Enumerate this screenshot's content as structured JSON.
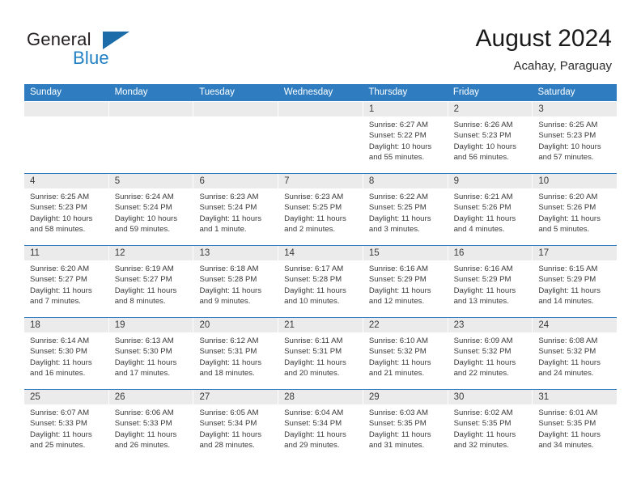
{
  "brand": {
    "name_part1": "General",
    "name_part2": "Blue"
  },
  "header": {
    "month_title": "August 2024",
    "location": "Acahay, Paraguay"
  },
  "colors": {
    "header_blue": "#2f7dc0",
    "logo_blue": "#1f7fc4",
    "daynum_band": "#ebebeb",
    "text": "#3a3a3a"
  },
  "weekdays": [
    "Sunday",
    "Monday",
    "Tuesday",
    "Wednesday",
    "Thursday",
    "Friday",
    "Saturday"
  ],
  "weeks": [
    [
      {
        "day": "",
        "empty": true
      },
      {
        "day": "",
        "empty": true
      },
      {
        "day": "",
        "empty": true
      },
      {
        "day": "",
        "empty": true
      },
      {
        "day": "1",
        "sunrise": "Sunrise: 6:27 AM",
        "sunset": "Sunset: 5:22 PM",
        "daylight_1": "Daylight: 10 hours",
        "daylight_2": "and 55 minutes."
      },
      {
        "day": "2",
        "sunrise": "Sunrise: 6:26 AM",
        "sunset": "Sunset: 5:23 PM",
        "daylight_1": "Daylight: 10 hours",
        "daylight_2": "and 56 minutes."
      },
      {
        "day": "3",
        "sunrise": "Sunrise: 6:25 AM",
        "sunset": "Sunset: 5:23 PM",
        "daylight_1": "Daylight: 10 hours",
        "daylight_2": "and 57 minutes."
      }
    ],
    [
      {
        "day": "4",
        "sunrise": "Sunrise: 6:25 AM",
        "sunset": "Sunset: 5:23 PM",
        "daylight_1": "Daylight: 10 hours",
        "daylight_2": "and 58 minutes."
      },
      {
        "day": "5",
        "sunrise": "Sunrise: 6:24 AM",
        "sunset": "Sunset: 5:24 PM",
        "daylight_1": "Daylight: 10 hours",
        "daylight_2": "and 59 minutes."
      },
      {
        "day": "6",
        "sunrise": "Sunrise: 6:23 AM",
        "sunset": "Sunset: 5:24 PM",
        "daylight_1": "Daylight: 11 hours",
        "daylight_2": "and 1 minute."
      },
      {
        "day": "7",
        "sunrise": "Sunrise: 6:23 AM",
        "sunset": "Sunset: 5:25 PM",
        "daylight_1": "Daylight: 11 hours",
        "daylight_2": "and 2 minutes."
      },
      {
        "day": "8",
        "sunrise": "Sunrise: 6:22 AM",
        "sunset": "Sunset: 5:25 PM",
        "daylight_1": "Daylight: 11 hours",
        "daylight_2": "and 3 minutes."
      },
      {
        "day": "9",
        "sunrise": "Sunrise: 6:21 AM",
        "sunset": "Sunset: 5:26 PM",
        "daylight_1": "Daylight: 11 hours",
        "daylight_2": "and 4 minutes."
      },
      {
        "day": "10",
        "sunrise": "Sunrise: 6:20 AM",
        "sunset": "Sunset: 5:26 PM",
        "daylight_1": "Daylight: 11 hours",
        "daylight_2": "and 5 minutes."
      }
    ],
    [
      {
        "day": "11",
        "sunrise": "Sunrise: 6:20 AM",
        "sunset": "Sunset: 5:27 PM",
        "daylight_1": "Daylight: 11 hours",
        "daylight_2": "and 7 minutes."
      },
      {
        "day": "12",
        "sunrise": "Sunrise: 6:19 AM",
        "sunset": "Sunset: 5:27 PM",
        "daylight_1": "Daylight: 11 hours",
        "daylight_2": "and 8 minutes."
      },
      {
        "day": "13",
        "sunrise": "Sunrise: 6:18 AM",
        "sunset": "Sunset: 5:28 PM",
        "daylight_1": "Daylight: 11 hours",
        "daylight_2": "and 9 minutes."
      },
      {
        "day": "14",
        "sunrise": "Sunrise: 6:17 AM",
        "sunset": "Sunset: 5:28 PM",
        "daylight_1": "Daylight: 11 hours",
        "daylight_2": "and 10 minutes."
      },
      {
        "day": "15",
        "sunrise": "Sunrise: 6:16 AM",
        "sunset": "Sunset: 5:29 PM",
        "daylight_1": "Daylight: 11 hours",
        "daylight_2": "and 12 minutes."
      },
      {
        "day": "16",
        "sunrise": "Sunrise: 6:16 AM",
        "sunset": "Sunset: 5:29 PM",
        "daylight_1": "Daylight: 11 hours",
        "daylight_2": "and 13 minutes."
      },
      {
        "day": "17",
        "sunrise": "Sunrise: 6:15 AM",
        "sunset": "Sunset: 5:29 PM",
        "daylight_1": "Daylight: 11 hours",
        "daylight_2": "and 14 minutes."
      }
    ],
    [
      {
        "day": "18",
        "sunrise": "Sunrise: 6:14 AM",
        "sunset": "Sunset: 5:30 PM",
        "daylight_1": "Daylight: 11 hours",
        "daylight_2": "and 16 minutes."
      },
      {
        "day": "19",
        "sunrise": "Sunrise: 6:13 AM",
        "sunset": "Sunset: 5:30 PM",
        "daylight_1": "Daylight: 11 hours",
        "daylight_2": "and 17 minutes."
      },
      {
        "day": "20",
        "sunrise": "Sunrise: 6:12 AM",
        "sunset": "Sunset: 5:31 PM",
        "daylight_1": "Daylight: 11 hours",
        "daylight_2": "and 18 minutes."
      },
      {
        "day": "21",
        "sunrise": "Sunrise: 6:11 AM",
        "sunset": "Sunset: 5:31 PM",
        "daylight_1": "Daylight: 11 hours",
        "daylight_2": "and 20 minutes."
      },
      {
        "day": "22",
        "sunrise": "Sunrise: 6:10 AM",
        "sunset": "Sunset: 5:32 PM",
        "daylight_1": "Daylight: 11 hours",
        "daylight_2": "and 21 minutes."
      },
      {
        "day": "23",
        "sunrise": "Sunrise: 6:09 AM",
        "sunset": "Sunset: 5:32 PM",
        "daylight_1": "Daylight: 11 hours",
        "daylight_2": "and 22 minutes."
      },
      {
        "day": "24",
        "sunrise": "Sunrise: 6:08 AM",
        "sunset": "Sunset: 5:32 PM",
        "daylight_1": "Daylight: 11 hours",
        "daylight_2": "and 24 minutes."
      }
    ],
    [
      {
        "day": "25",
        "sunrise": "Sunrise: 6:07 AM",
        "sunset": "Sunset: 5:33 PM",
        "daylight_1": "Daylight: 11 hours",
        "daylight_2": "and 25 minutes."
      },
      {
        "day": "26",
        "sunrise": "Sunrise: 6:06 AM",
        "sunset": "Sunset: 5:33 PM",
        "daylight_1": "Daylight: 11 hours",
        "daylight_2": "and 26 minutes."
      },
      {
        "day": "27",
        "sunrise": "Sunrise: 6:05 AM",
        "sunset": "Sunset: 5:34 PM",
        "daylight_1": "Daylight: 11 hours",
        "daylight_2": "and 28 minutes."
      },
      {
        "day": "28",
        "sunrise": "Sunrise: 6:04 AM",
        "sunset": "Sunset: 5:34 PM",
        "daylight_1": "Daylight: 11 hours",
        "daylight_2": "and 29 minutes."
      },
      {
        "day": "29",
        "sunrise": "Sunrise: 6:03 AM",
        "sunset": "Sunset: 5:35 PM",
        "daylight_1": "Daylight: 11 hours",
        "daylight_2": "and 31 minutes."
      },
      {
        "day": "30",
        "sunrise": "Sunrise: 6:02 AM",
        "sunset": "Sunset: 5:35 PM",
        "daylight_1": "Daylight: 11 hours",
        "daylight_2": "and 32 minutes."
      },
      {
        "day": "31",
        "sunrise": "Sunrise: 6:01 AM",
        "sunset": "Sunset: 5:35 PM",
        "daylight_1": "Daylight: 11 hours",
        "daylight_2": "and 34 minutes."
      }
    ]
  ]
}
